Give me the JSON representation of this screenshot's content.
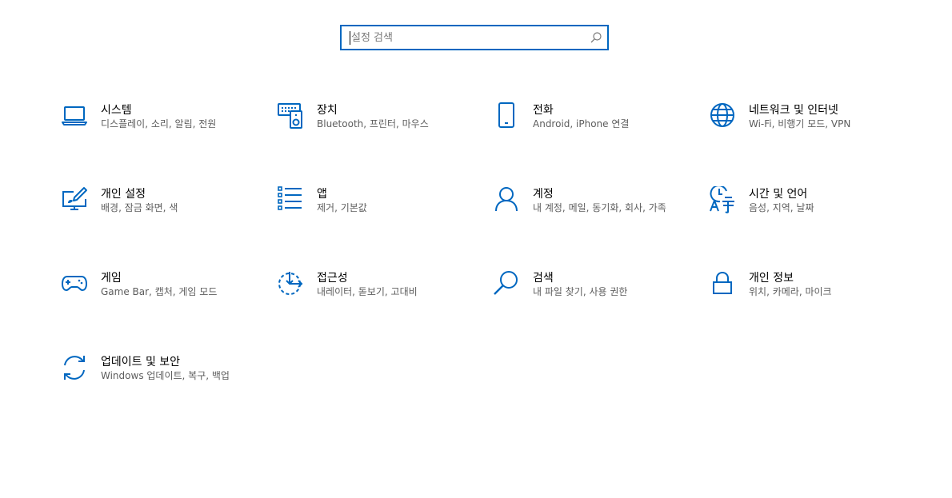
{
  "search": {
    "placeholder": "설정 검색",
    "value": ""
  },
  "accent_color": "#0067c0",
  "tiles": [
    {
      "title": "시스템",
      "desc": "디스플레이, 소리, 알림, 전원",
      "icon": "laptop-icon"
    },
    {
      "title": "장치",
      "desc": "Bluetooth, 프린터, 마우스",
      "icon": "devices-icon"
    },
    {
      "title": "전화",
      "desc": "Android, iPhone 연결",
      "icon": "phone-icon"
    },
    {
      "title": "네트워크 및 인터넷",
      "desc": "Wi-Fi, 비행기 모드, VPN",
      "icon": "globe-icon"
    },
    {
      "title": "개인 설정",
      "desc": "배경, 잠금 화면, 색",
      "icon": "personalization-icon"
    },
    {
      "title": "앱",
      "desc": "제거, 기본값",
      "icon": "apps-list-icon"
    },
    {
      "title": "계정",
      "desc": "내 계정, 메일, 동기화, 회사, 가족",
      "icon": "person-icon"
    },
    {
      "title": "시간 및 언어",
      "desc": "음성, 지역, 날짜",
      "icon": "time-language-icon"
    },
    {
      "title": "게임",
      "desc": "Game Bar, 캡처, 게임 모드",
      "icon": "gamepad-icon"
    },
    {
      "title": "접근성",
      "desc": "내레이터, 돋보기, 고대비",
      "icon": "ease-of-access-icon"
    },
    {
      "title": "검색",
      "desc": "내 파일 찾기, 사용 권한",
      "icon": "magnifier-icon"
    },
    {
      "title": "개인 정보",
      "desc": "위치, 카메라, 마이크",
      "icon": "lock-icon"
    },
    {
      "title": "업데이트 및 보안",
      "desc": "Windows 업데이트, 복구, 백업",
      "icon": "update-icon"
    }
  ]
}
